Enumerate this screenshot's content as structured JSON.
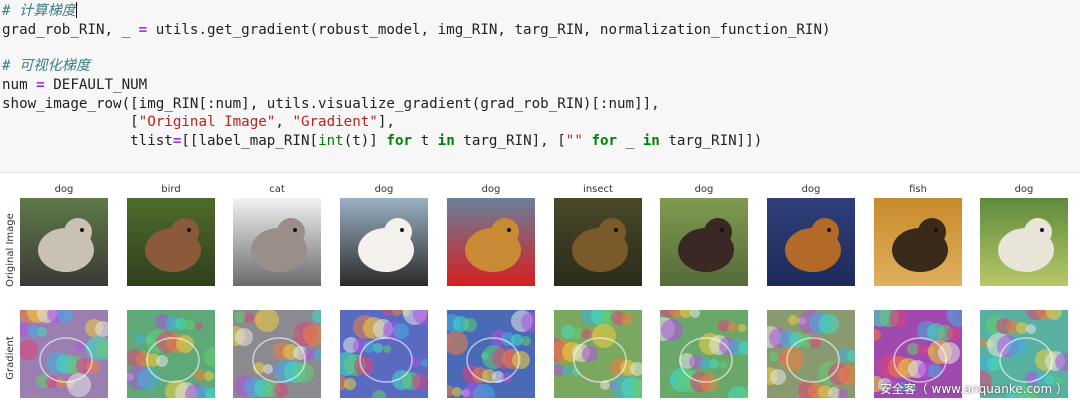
{
  "code": {
    "comment1": "# 计算梯度",
    "line1": {
      "a": "grad_rob_RIN, _ ",
      "eq": "=",
      "b": " utils.get_gradient(robust_model, img_RIN, targ_RIN, normalization_function_RIN)"
    },
    "comment2": "# 可视化梯度",
    "line2": {
      "a": "num ",
      "eq": "=",
      "b": " DEFAULT_NUM"
    },
    "line3": "show_image_row([img_RIN[:num], utils.visualize_gradient(grad_rob_RIN)[:num]],",
    "line4": {
      "indent": "               [",
      "s1": "\"Original Image\"",
      "sep": ", ",
      "s2": "\"Gradient\"",
      "end": "],"
    },
    "line5": {
      "indent": "               tlist",
      "eq": "=",
      "a": "[[label_map_RIN[",
      "int": "int",
      "b": "(t)] ",
      "for1": "for",
      "c": " t ",
      "in1": "in",
      "d": " targ_RIN], [",
      "empty": "\"\"",
      "e": " ",
      "for2": "for",
      "f": " _ ",
      "in2": "in",
      "g": " targ_RIN]])"
    }
  },
  "figure": {
    "row_labels": [
      "Original Image",
      "Gradient"
    ],
    "titles": [
      "dog",
      "bird",
      "cat",
      "dog",
      "dog",
      "insect",
      "dog",
      "dog",
      "fish",
      "dog"
    ],
    "watermark": "安全客（ www.anquanke.com ）",
    "colors": {
      "originals": [
        [
          "#5f7a4a",
          "#c9c2b2",
          "#3b3a35"
        ],
        [
          "#4f6b2a",
          "#8b5a3a",
          "#2f3f1e"
        ],
        [
          "#f2f2f2",
          "#9a8f88",
          "#6b6b6b"
        ],
        [
          "#9ab0c4",
          "#f4f1ec",
          "#2b2b2b"
        ],
        [
          "#6a7f9a",
          "#c98a35",
          "#d51f1f"
        ],
        [
          "#4a4a2a",
          "#7a5a2a",
          "#2a2a1a"
        ],
        [
          "#7e9b4f",
          "#3a2824",
          "#556b3a"
        ],
        [
          "#2f3f7a",
          "#b36a28",
          "#1e2a5a"
        ],
        [
          "#c88a2a",
          "#3a2a1a",
          "#e0b060"
        ],
        [
          "#5e8a3a",
          "#e8e4d8",
          "#b8c86a"
        ]
      ],
      "gradients": [
        "#9a7fb0",
        "#5fa878",
        "#8a8a90",
        "#5a6ac0",
        "#4a6ab8",
        "#7aa860",
        "#6aa86a",
        "#8a9a70",
        "#a04ab0",
        "#5ab0a0"
      ]
    }
  }
}
